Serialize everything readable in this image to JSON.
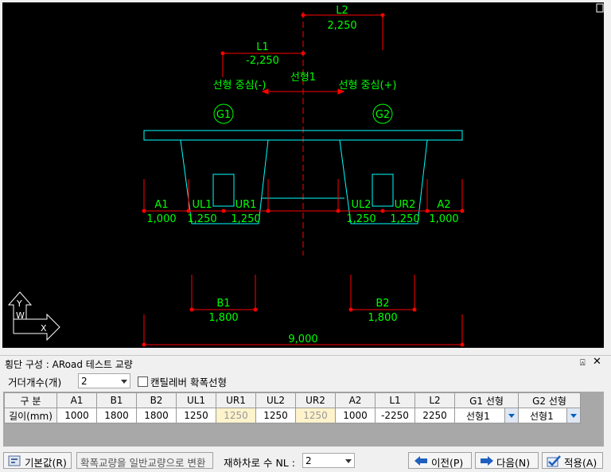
{
  "drawing": {
    "top_label": "L2",
    "top_value": "2,250",
    "left_label": "L1",
    "left_value": "-2,250",
    "center_label": "선형1",
    "left_center": "선형 중심(-)",
    "right_center": "선형 중심(+)",
    "girders": [
      "G1",
      "G2"
    ],
    "dims": [
      {
        "label": "A1",
        "value": "1,000"
      },
      {
        "label": "UL1",
        "value": "1,250"
      },
      {
        "label": "UR1",
        "value": "1,250"
      },
      {
        "label": "UL2",
        "value": "1,250"
      },
      {
        "label": "UR2",
        "value": "1,250"
      },
      {
        "label": "A2",
        "value": "1,000"
      }
    ],
    "b1_label": "B1",
    "b1_value": "1,800",
    "b2_label": "B2",
    "b2_value": "1,800",
    "total_value": "9,000",
    "axis_y": "Y",
    "axis_w": "W",
    "axis_x": "X"
  },
  "panel": {
    "title": "횡단 구성 : ARoad 테스트 교량",
    "pin_icon": "pin-icon",
    "close_icon": "close-icon"
  },
  "form": {
    "girder_count_label": "거더개수(개)",
    "girder_count_value": "2",
    "cantilever_label": "캔틸레버 확폭선형"
  },
  "grid": {
    "headers": [
      "구 분",
      "A1",
      "B1",
      "B2",
      "UL1",
      "UR1",
      "UL2",
      "UR2",
      "A2",
      "L1",
      "L2",
      "G1 선형",
      "G2 선형"
    ],
    "row_label": "길이(mm)",
    "values": [
      "1000",
      "1800",
      "1800",
      "1250",
      "1250",
      "1250",
      "1250",
      "1000",
      "-2250",
      "2250",
      "선형1",
      "선형1"
    ]
  },
  "bottom": {
    "default_button": "기본값(R)",
    "convert_button": "확폭교량을 일반교량으로 변환",
    "lanes_label": "재하차로 수 NL :",
    "lanes_value": "2",
    "prev_button": "이전(P)",
    "next_button": "다음(N)",
    "apply_button": "적용(A)"
  },
  "colors": {
    "cad_bg": "#000000",
    "dim_red": "#ff0000",
    "text_green": "#00ff00",
    "section_cyan": "#00ffff",
    "highlight_cell": "#fff3cc"
  }
}
